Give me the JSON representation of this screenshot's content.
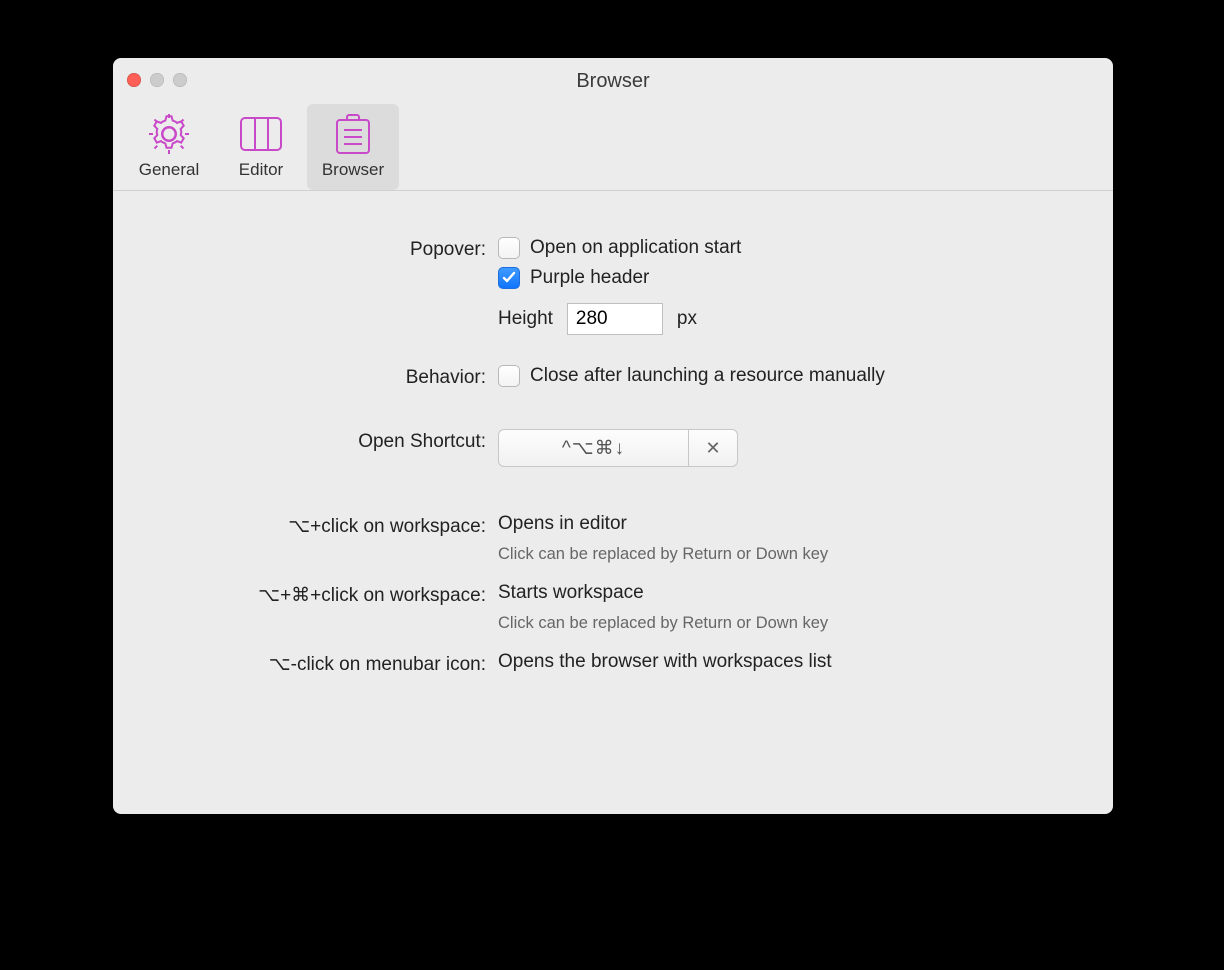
{
  "window": {
    "title": "Browser"
  },
  "tabs": {
    "general": "General",
    "editor": "Editor",
    "browser": "Browser"
  },
  "form": {
    "popover_label": "Popover:",
    "open_on_start": "Open on application start",
    "purple_header": "Purple header",
    "height_label": "Height",
    "height_value": "280",
    "height_unit": "px",
    "behavior_label": "Behavior:",
    "close_after": "Close after launching a resource manually",
    "shortcut_label": "Open Shortcut:",
    "shortcut_value": "^⌥⌘↓",
    "clear_glyph": "✕"
  },
  "hints": {
    "h1_label": "⌥+click on workspace:",
    "h1_main": "Opens in editor",
    "h1_sub": "Click can be replaced by Return or Down key",
    "h2_label": "⌥+⌘+click on workspace:",
    "h2_main": "Starts workspace",
    "h2_sub": "Click can be replaced by Return or Down key",
    "h3_label": "⌥-click on menubar icon:",
    "h3_main": "Opens the browser with workspaces list"
  }
}
